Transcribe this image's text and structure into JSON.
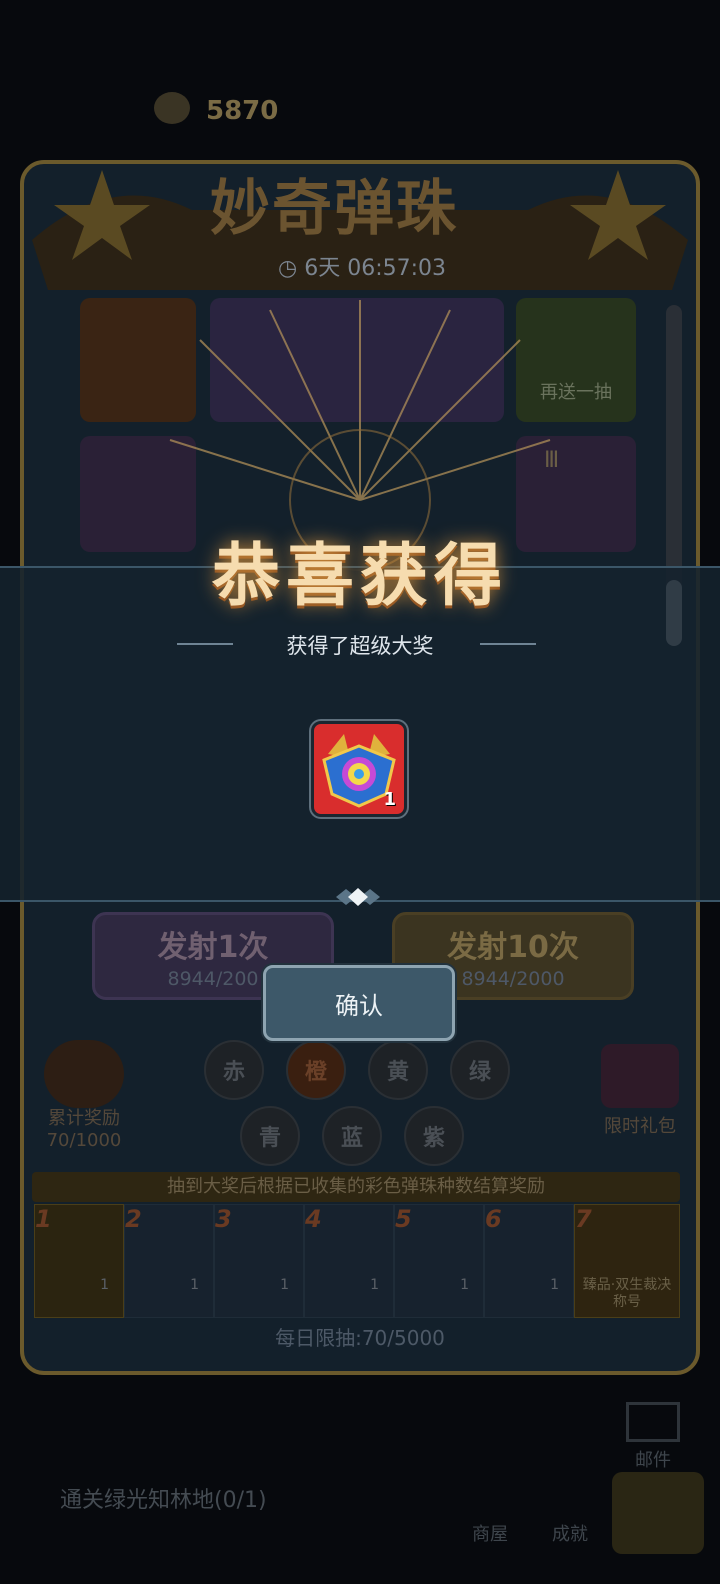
{
  "header": {
    "currency_value": "5870"
  },
  "event": {
    "title": "妙奇弹珠",
    "timer": "6天 06:57:03"
  },
  "board": {
    "cell_labels": [
      "再送一抽",
      "Ⅲ"
    ]
  },
  "fire": {
    "single_label": "发射1次",
    "single_cost": "8944/200",
    "ten_label": "发射10次",
    "ten_cost": "8944/2000"
  },
  "balls": [
    "赤",
    "橙",
    "黄",
    "绿",
    "青",
    "蓝",
    "紫"
  ],
  "side": {
    "left_label": "累计奖励",
    "left_progress": "70/1000",
    "right_label": "限时礼包"
  },
  "rewards": {
    "hint": "抽到大奖后根据已收集的彩色弹珠种数结算奖励",
    "slots": [
      {
        "num": "1",
        "count": "1"
      },
      {
        "num": "2",
        "count": "1"
      },
      {
        "num": "3",
        "count": "1"
      },
      {
        "num": "4",
        "count": "1"
      },
      {
        "num": "5",
        "count": "1"
      },
      {
        "num": "6",
        "count": "1"
      },
      {
        "num": "7",
        "name": "臻品·双生裁决称号"
      }
    ]
  },
  "daily_limit": "每日限抽:70/5000",
  "bottom": {
    "quest": "通关绿光知林地(0/1)",
    "mail": "邮件",
    "shop": "商屋",
    "achievement": "成就"
  },
  "modal": {
    "title": "恭喜获得",
    "subtitle": "获得了超级大奖",
    "item_count": "1",
    "confirm": "确认"
  },
  "colors": {
    "accent_gold": "#f6dcaf",
    "item_bg": "#d92d2d",
    "confirm_bg": "#3d5869"
  }
}
